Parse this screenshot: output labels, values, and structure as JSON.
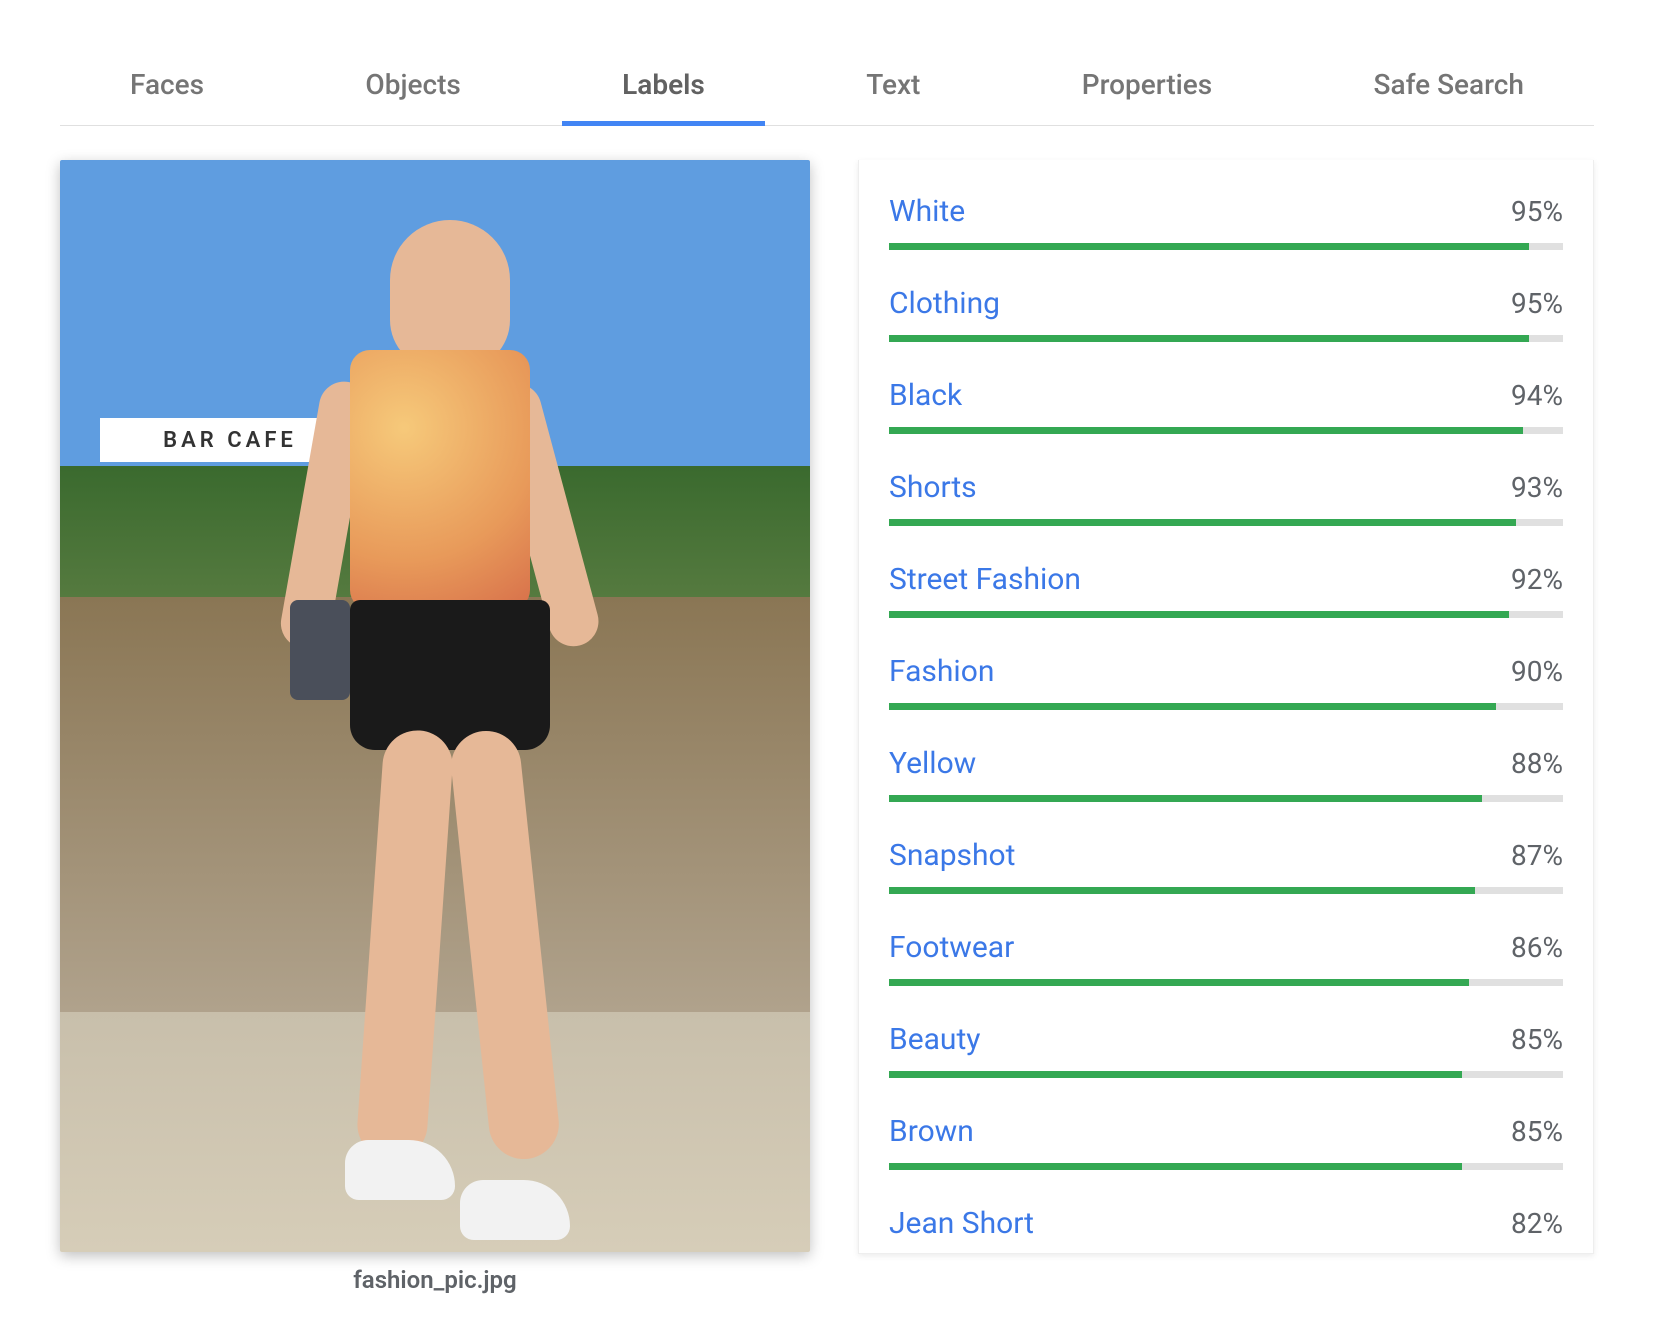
{
  "tabs": [
    {
      "id": "faces",
      "label": "Faces",
      "active": false
    },
    {
      "id": "objects",
      "label": "Objects",
      "active": false
    },
    {
      "id": "labels",
      "label": "Labels",
      "active": true
    },
    {
      "id": "text",
      "label": "Text",
      "active": false
    },
    {
      "id": "properties",
      "label": "Properties",
      "active": false
    },
    {
      "id": "safesearch",
      "label": "Safe Search",
      "active": false
    }
  ],
  "image": {
    "filename": "fashion_pic.jpg",
    "background_sign_text": "BAR   CAFE"
  },
  "labels": [
    {
      "name": "White",
      "pct": 95
    },
    {
      "name": "Clothing",
      "pct": 95
    },
    {
      "name": "Black",
      "pct": 94
    },
    {
      "name": "Shorts",
      "pct": 93
    },
    {
      "name": "Street Fashion",
      "pct": 92
    },
    {
      "name": "Fashion",
      "pct": 90
    },
    {
      "name": "Yellow",
      "pct": 88
    },
    {
      "name": "Snapshot",
      "pct": 87
    },
    {
      "name": "Footwear",
      "pct": 86
    },
    {
      "name": "Beauty",
      "pct": 85
    },
    {
      "name": "Brown",
      "pct": 85
    },
    {
      "name": "Jean Short",
      "pct": 82
    }
  ],
  "colors": {
    "accent_blue": "#3b78e7",
    "tab_underline": "#4285f4",
    "bar_green": "#34a853",
    "bar_track": "#e0e0e0",
    "text_muted": "#5f6368"
  }
}
